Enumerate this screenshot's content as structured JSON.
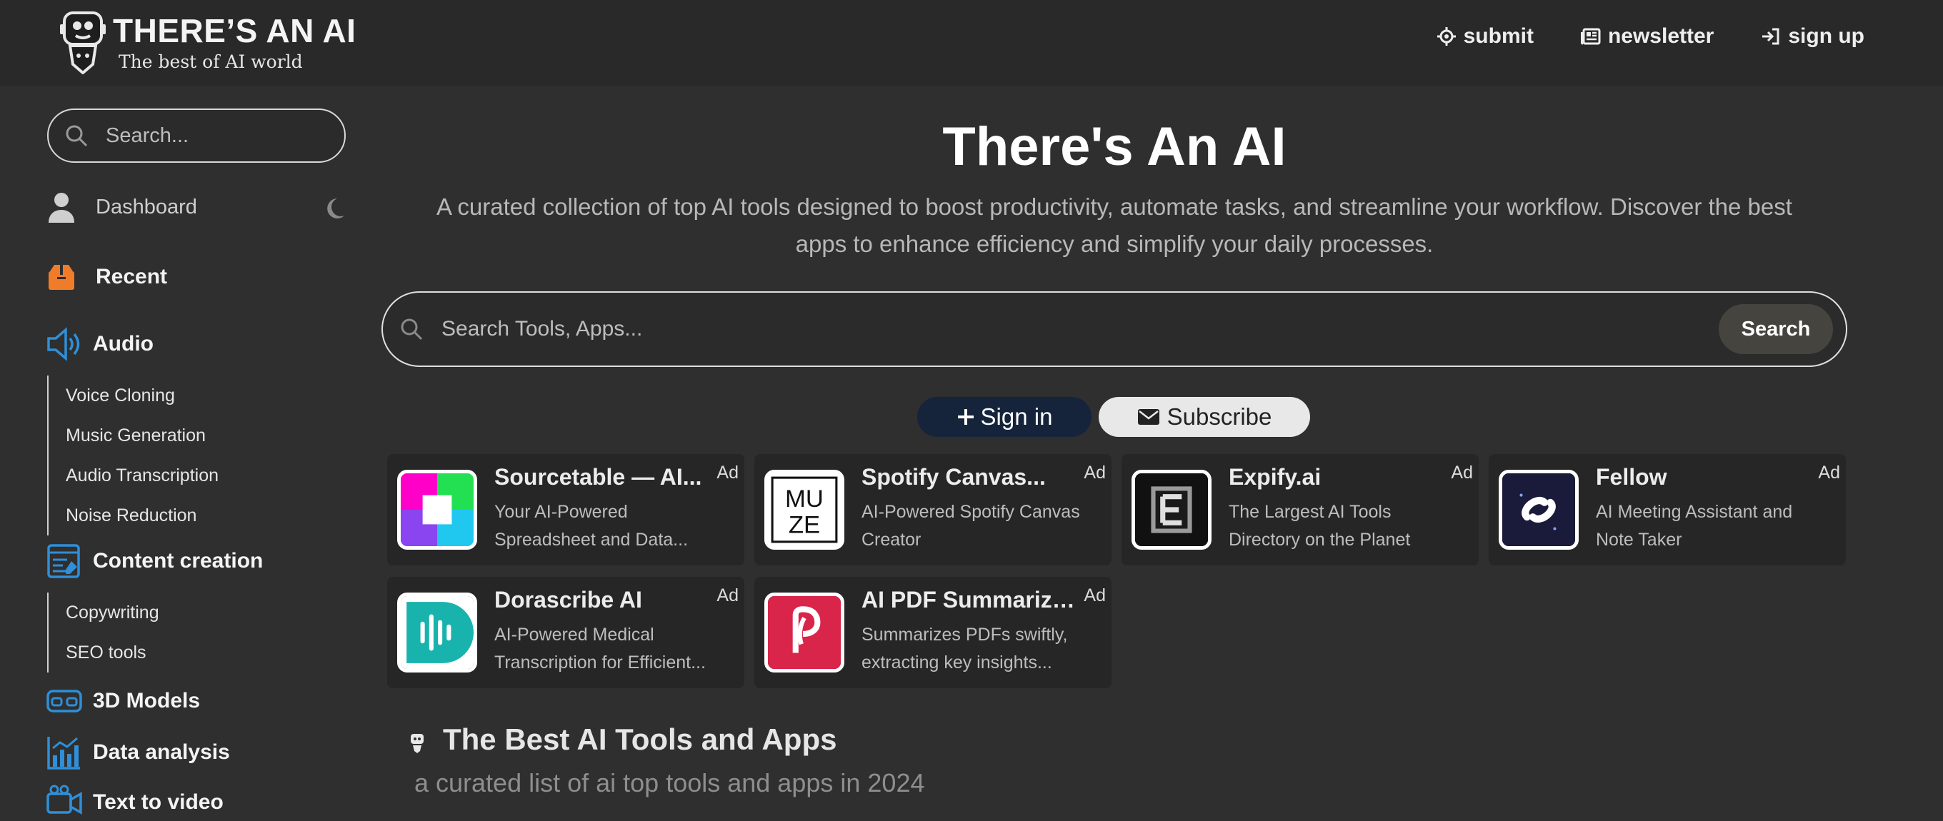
{
  "brand": {
    "title": "THERE’S AN AI",
    "tagline": "The best of AI world"
  },
  "topnav": [
    {
      "label": "submit",
      "icon": "crosshair-icon"
    },
    {
      "label": "newsletter",
      "icon": "newspaper-icon"
    },
    {
      "label": "sign up",
      "icon": "sign-in-icon"
    }
  ],
  "sidebar": {
    "search_placeholder": "Search...",
    "dashboard": "Dashboard",
    "recent": "Recent",
    "categories": [
      {
        "label": "Audio",
        "icon": "audio-icon",
        "subs": [
          "Voice Cloning",
          "Music Generation",
          "Audio Transcription",
          "Noise Reduction"
        ]
      },
      {
        "label": "Content creation",
        "icon": "content-creation-icon",
        "subs": [
          "Copywriting",
          "SEO tools"
        ]
      },
      {
        "label": "3D Models",
        "icon": "vr-headset-icon",
        "subs": []
      },
      {
        "label": "Data analysis",
        "icon": "chart-icon",
        "subs": []
      },
      {
        "label": "Text to video",
        "icon": "video-icon",
        "subs": []
      }
    ]
  },
  "hero": {
    "title": "There's An AI",
    "description_line1": "A curated collection of top AI tools designed to boost productivity, automate tasks, and streamline your workflow. Discover the best",
    "description_line2": "apps to enhance efficiency and simplify your daily processes."
  },
  "search": {
    "placeholder": "Search Tools, Apps...",
    "button": "Search"
  },
  "auth": {
    "signin": "Sign in",
    "subscribe": "Subscribe"
  },
  "ads": [
    {
      "name": "Sourcetable — AI...",
      "badge": "Ad",
      "desc1": "Your AI-Powered",
      "desc2": "Spreadsheet and Data..."
    },
    {
      "name": "Spotify Canvas...",
      "badge": "Ad",
      "desc1": "AI-Powered Spotify Canvas",
      "desc2": "Creator",
      "logo_text1": "MU",
      "logo_text2": "ZE"
    },
    {
      "name": "Expify.ai",
      "badge": "Ad",
      "desc1": "The Largest AI Tools",
      "desc2": "Directory on the Planet"
    },
    {
      "name": "Fellow",
      "badge": "Ad",
      "desc1": "AI Meeting Assistant and",
      "desc2": "Note Taker"
    },
    {
      "name": "Dorascribe AI",
      "badge": "Ad",
      "desc1": "AI-Powered Medical",
      "desc2": "Transcription for Efficient..."
    },
    {
      "name": "AI PDF Summarizer...",
      "badge": "Ad",
      "desc1": "Summarizes PDFs swiftly,",
      "desc2": "extracting key insights..."
    }
  ],
  "section": {
    "title": "The Best AI Tools and Apps",
    "subtitle": "a curated list of ai top tools and apps in 2024"
  },
  "colors": {
    "accent_blue": "#2f8fd8",
    "recent_orange": "#f07c2a",
    "signin_bg": "#15243a"
  }
}
